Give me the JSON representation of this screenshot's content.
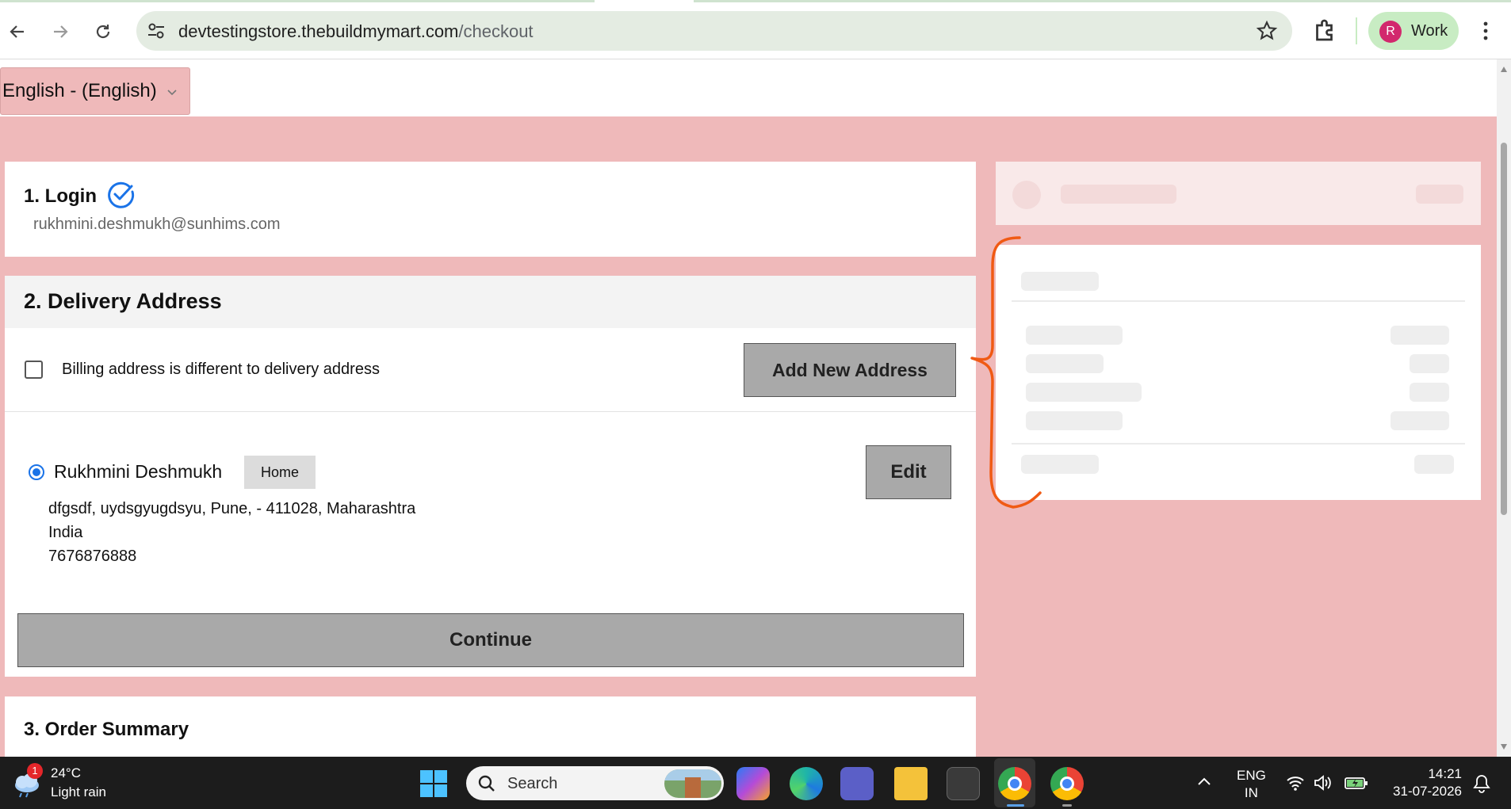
{
  "browser": {
    "url_domain": "devtestingstore.thebuildmymart.com",
    "url_path": "/checkout",
    "profile_initial": "R",
    "profile_label": "Work"
  },
  "page": {
    "language_select": "English - (English)",
    "login": {
      "title": "1. Login",
      "email": "rukhmini.deshmukh@sunhims.com"
    },
    "delivery": {
      "title": "2. Delivery Address",
      "billing_label": "Billing address is different to delivery address",
      "billing_checked": false,
      "add_address_label": "Add New Address",
      "address": {
        "name": "Rukhmini Deshmukh",
        "tag": "Home",
        "line1": "dfgsdf, uydsgyugdsyu, Pune, - 411028, Maharashtra",
        "country": "India",
        "phone": "7676876888",
        "selected": true
      },
      "edit_label": "Edit",
      "continue_label": "Continue"
    },
    "order_summary": {
      "title": "3. Order Summary"
    }
  },
  "taskbar": {
    "weather_badge": "1",
    "weather_temp": "24°C",
    "weather_desc": "Light rain",
    "search_placeholder": "Search",
    "lang_line1": "ENG",
    "lang_line2": "IN",
    "time": "14:21",
    "date": "31-07-2026"
  },
  "colors": {
    "page_background": "#efb9ba",
    "button_grey": "#a9a9a9",
    "accent_blue": "#1a73e8",
    "annotation_orange": "#f05a14"
  }
}
